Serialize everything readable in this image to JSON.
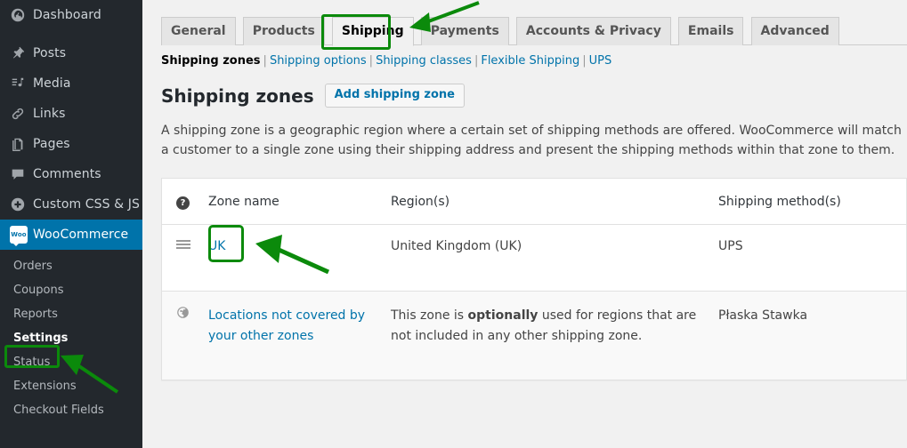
{
  "theme": {
    "sidebar_bg": "#23282d",
    "sidebar_current_bg": "#0073aa",
    "link_color": "#0073aa",
    "annotation_green": "#0b8a0b",
    "content_bg": "#f1f1f1"
  },
  "sidebar": {
    "items": [
      {
        "label": "Dashboard",
        "icon": "dashboard-icon"
      },
      {
        "label": "Posts",
        "icon": "pin-icon"
      },
      {
        "label": "Media",
        "icon": "media-icon"
      },
      {
        "label": "Links",
        "icon": "link-icon"
      },
      {
        "label": "Pages",
        "icon": "pages-icon"
      },
      {
        "label": "Comments",
        "icon": "comment-icon"
      },
      {
        "label": "Custom CSS & JS",
        "icon": "plus-circle-icon"
      },
      {
        "label": "WooCommerce",
        "icon": "woocommerce-icon"
      }
    ],
    "submenu": [
      {
        "label": "Orders",
        "highlighted": false
      },
      {
        "label": "Coupons",
        "highlighted": false
      },
      {
        "label": "Reports",
        "highlighted": false
      },
      {
        "label": "Settings",
        "highlighted": true
      },
      {
        "label": "Status",
        "highlighted": false
      },
      {
        "label": "Extensions",
        "highlighted": false
      },
      {
        "label": "Checkout Fields",
        "highlighted": false
      }
    ]
  },
  "tabs": [
    {
      "label": "General",
      "active": false
    },
    {
      "label": "Products",
      "active": false
    },
    {
      "label": "Shipping",
      "active": true
    },
    {
      "label": "Payments",
      "active": false
    },
    {
      "label": "Accounts & Privacy",
      "active": false
    },
    {
      "label": "Emails",
      "active": false
    },
    {
      "label": "Advanced",
      "active": false
    }
  ],
  "subnav": [
    {
      "label": "Shipping zones",
      "current": true
    },
    {
      "label": "Shipping options",
      "current": false
    },
    {
      "label": "Shipping classes",
      "current": false
    },
    {
      "label": "Flexible Shipping",
      "current": false
    },
    {
      "label": "UPS",
      "current": false
    }
  ],
  "subnav_separator": "|",
  "page": {
    "title": "Shipping zones",
    "add_button": "Add shipping zone",
    "description": "A shipping zone is a geographic region where a certain set of shipping methods are offered. WooCommerce will match a customer to a single zone using their shipping address and present the shipping methods within that zone to them."
  },
  "table": {
    "help_tip": "?",
    "columns": {
      "sort": "",
      "zone_name": "Zone name",
      "regions": "Region(s)",
      "methods": "Shipping method(s)"
    },
    "rows": [
      {
        "icon": "drag-handle-icon",
        "zone_name": "UK",
        "regions": "United Kingdom (UK)",
        "methods": "UPS",
        "worldwide": false
      },
      {
        "icon": "globe-icon",
        "zone_name": "Locations not covered by your other zones",
        "regions_prefix": "This zone is ",
        "regions_bold": "optionally",
        "regions_suffix": " used for regions that are not included in any other shipping zone.",
        "methods": "Płaska Stawka",
        "worldwide": true
      }
    ]
  },
  "annotations": {
    "highlight_shipping_tab": "Shipping",
    "highlight_settings_menu": "Settings",
    "highlight_zone_uk": "UK",
    "arrow_count": 3
  }
}
